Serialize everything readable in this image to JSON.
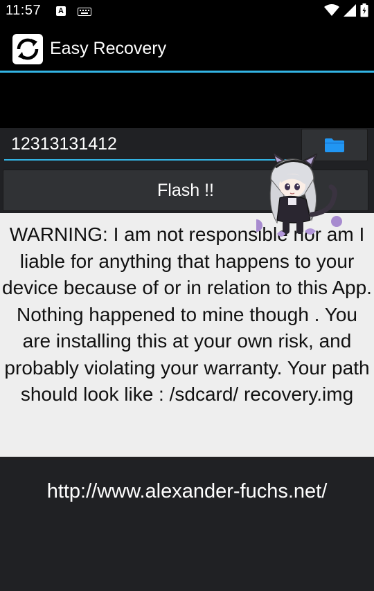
{
  "status_bar": {
    "time": "11:57",
    "notification_icons": [
      "a-box-icon",
      "keyboard-icon"
    ],
    "system_icons": [
      "wifi-icon",
      "signal-icon",
      "battery-icon"
    ]
  },
  "app_bar": {
    "title": "Easy Recovery",
    "app_icon": "refresh-icon"
  },
  "path_input": {
    "value": "12313131412"
  },
  "browse_button": {
    "icon": "folder-icon"
  },
  "flash_button": {
    "label": "Flash !!"
  },
  "warning": {
    "text": "WARNING: I am not responsible nor am I liable for anything that happens to your device because of or in relation to this App. Nothing happened to mine though . You are installing this at your own risk, and probably violating your warranty. Your path should look like : /sdcard/ recovery.img"
  },
  "footer": {
    "link": "http://www.alexander-fuchs.net/"
  },
  "colors": {
    "accent": "#33b5e5",
    "background": "#202124",
    "panel": "#eeeeee",
    "button": "#303235",
    "folder": "#2196f3"
  }
}
